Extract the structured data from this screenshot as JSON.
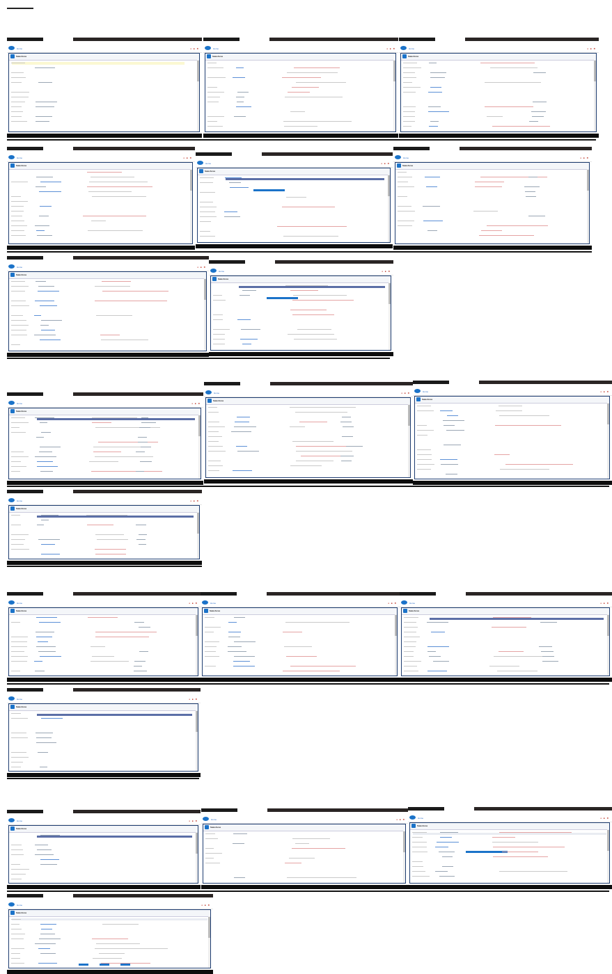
{
  "page": {
    "rows": [
      {
        "label": "Row 1",
        "shots": 3
      },
      {
        "label": "Row 2",
        "shots": 3
      },
      {
        "label": "Row 3",
        "shots": 2
      },
      {
        "label": "Row 4",
        "shots": 3
      },
      {
        "label": "Row 5",
        "shots": 1
      },
      {
        "label": "Row 6",
        "shots": 3
      },
      {
        "label": "Row 7",
        "shots": 1
      },
      {
        "label": "Row 8",
        "shots": 3
      },
      {
        "label": "Row 9",
        "shots": 1
      }
    ]
  },
  "shot": {
    "panel_title": "Salesforce",
    "nav_label": "Home",
    "icons": "● ■ ✖"
  },
  "colors": {
    "brand": "#1b73c9",
    "panel_border": "#1d3c70",
    "taskbar": "#0d0d0d",
    "highlight": "#fbf8d2",
    "accent_red": "#c0392b"
  }
}
